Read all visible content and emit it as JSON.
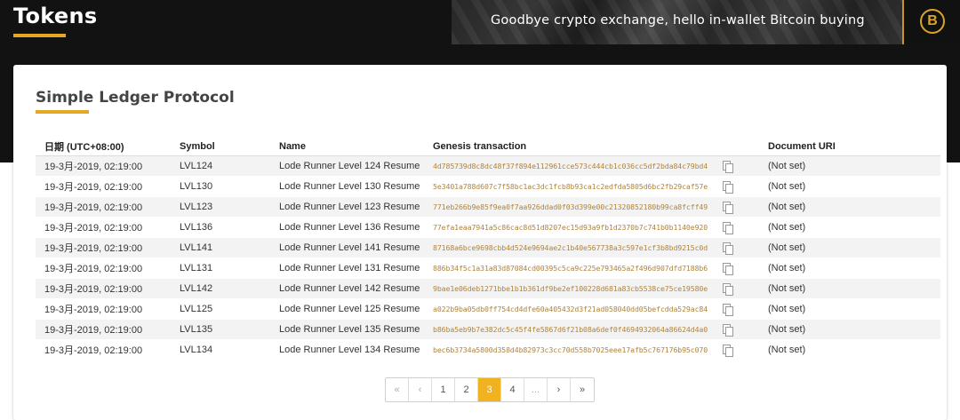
{
  "header": {
    "title": "Tokens",
    "banner_text": "Goodbye crypto exchange, hello in-wallet Bitcoin buying",
    "logo_glyph": "B",
    "accent_color": "#e4a724"
  },
  "section": {
    "title": "Simple Ledger Protocol"
  },
  "table": {
    "columns": [
      "日期 (UTC+08:00)",
      "Symbol",
      "Name",
      "Genesis transaction",
      "Document URI"
    ],
    "rows": [
      {
        "date": "19-3月-2019, 02:19:00",
        "symbol": "LVL124",
        "name": "Lode Runner Level 124 Resume",
        "hash": "4d785739d8c8dc48f37f894e112961cce573c444cb1c036cc5df2bda84c79bd4",
        "uri": "(Not set)"
      },
      {
        "date": "19-3月-2019, 02:19:00",
        "symbol": "LVL130",
        "name": "Lode Runner Level 130 Resume",
        "hash": "5e3401a788d607c7f58bc1ac3dc1fcb8b93ca1c2edfda5805d6bc2fb29caf57e",
        "uri": "(Not set)"
      },
      {
        "date": "19-3月-2019, 02:19:00",
        "symbol": "LVL123",
        "name": "Lode Runner Level 123 Resume",
        "hash": "771eb266b9e85f9ea0f7aa926ddad0f03d399e00c21320852180b99ca8fcff49",
        "uri": "(Not set)"
      },
      {
        "date": "19-3月-2019, 02:19:00",
        "symbol": "LVL136",
        "name": "Lode Runner Level 136 Resume",
        "hash": "77efa1eaa7941a5c86cac8d51d8207ec15d93a9fb1d2370b7c741b0b1140e920",
        "uri": "(Not set)"
      },
      {
        "date": "19-3月-2019, 02:19:00",
        "symbol": "LVL141",
        "name": "Lode Runner Level 141 Resume",
        "hash": "87168a6bce9698cbb4d524e9694ae2c1b40e567738a3c597e1cf3b8bd9215c0d",
        "uri": "(Not set)"
      },
      {
        "date": "19-3月-2019, 02:19:00",
        "symbol": "LVL131",
        "name": "Lode Runner Level 131 Resume",
        "hash": "886b34f5c1a31a83d87084cd00395c5ca9c225e793465a2f496d907dfd7188b6",
        "uri": "(Not set)"
      },
      {
        "date": "19-3月-2019, 02:19:00",
        "symbol": "LVL142",
        "name": "Lode Runner Level 142 Resume",
        "hash": "9bae1e06deb1271bbe1b1b361df9be2ef100228d681a83cb5538ce75ce19580e",
        "uri": "(Not set)"
      },
      {
        "date": "19-3月-2019, 02:19:00",
        "symbol": "LVL125",
        "name": "Lode Runner Level 125 Resume",
        "hash": "a022b9ba05db0ff754cd4dfe60a405432d3f21ad058040dd05befcdda529ac84",
        "uri": "(Not set)"
      },
      {
        "date": "19-3月-2019, 02:19:00",
        "symbol": "LVL135",
        "name": "Lode Runner Level 135 Resume",
        "hash": "b86ba5eb9b7e382dc5c45f4fe5867d6f21b08a6def0f4694932064a86624d4a0",
        "uri": "(Not set)"
      },
      {
        "date": "19-3月-2019, 02:19:00",
        "symbol": "LVL134",
        "name": "Lode Runner Level 134 Resume",
        "hash": "bec6b3734a5800d358d4b82973c3cc70d558b7025eee17afb5c767176b95c070",
        "uri": "(Not set)"
      }
    ]
  },
  "pagination": {
    "first": "«",
    "prev": "‹",
    "pages": [
      "1",
      "2",
      "3",
      "4"
    ],
    "active_page": "3",
    "ellipsis": "...",
    "next": "›",
    "last": "»"
  }
}
